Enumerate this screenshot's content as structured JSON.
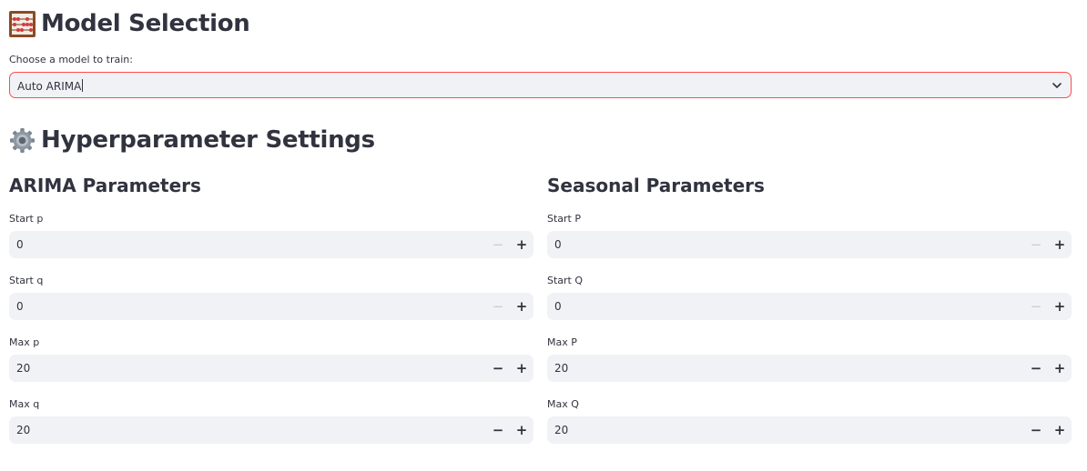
{
  "model_section": {
    "title": "Model Selection",
    "icon": "abacus-icon",
    "select_label": "Choose a model to train:",
    "select_value": "Auto ARIMA"
  },
  "hyper_section": {
    "title": "Hyperparameter Settings",
    "icon": "gear-icon"
  },
  "arima": {
    "heading": "ARIMA Parameters",
    "fields": [
      {
        "label": "Start p",
        "value": "0",
        "minus_disabled": true
      },
      {
        "label": "Start q",
        "value": "0",
        "minus_disabled": true
      },
      {
        "label": "Max p",
        "value": "20",
        "minus_disabled": false
      },
      {
        "label": "Max q",
        "value": "20",
        "minus_disabled": false
      }
    ]
  },
  "seasonal": {
    "heading": "Seasonal Parameters",
    "fields": [
      {
        "label": "Start P",
        "value": "0",
        "minus_disabled": true
      },
      {
        "label": "Start Q",
        "value": "0",
        "minus_disabled": true
      },
      {
        "label": "Max P",
        "value": "20",
        "minus_disabled": false
      },
      {
        "label": "Max Q",
        "value": "20",
        "minus_disabled": false
      }
    ]
  },
  "stepper": {
    "minus": "−",
    "plus": "+"
  },
  "colors": {
    "accent": "#ff4b4b",
    "input_bg": "#f0f2f6",
    "text": "#31333f",
    "disabled": "#c9cbd1"
  }
}
